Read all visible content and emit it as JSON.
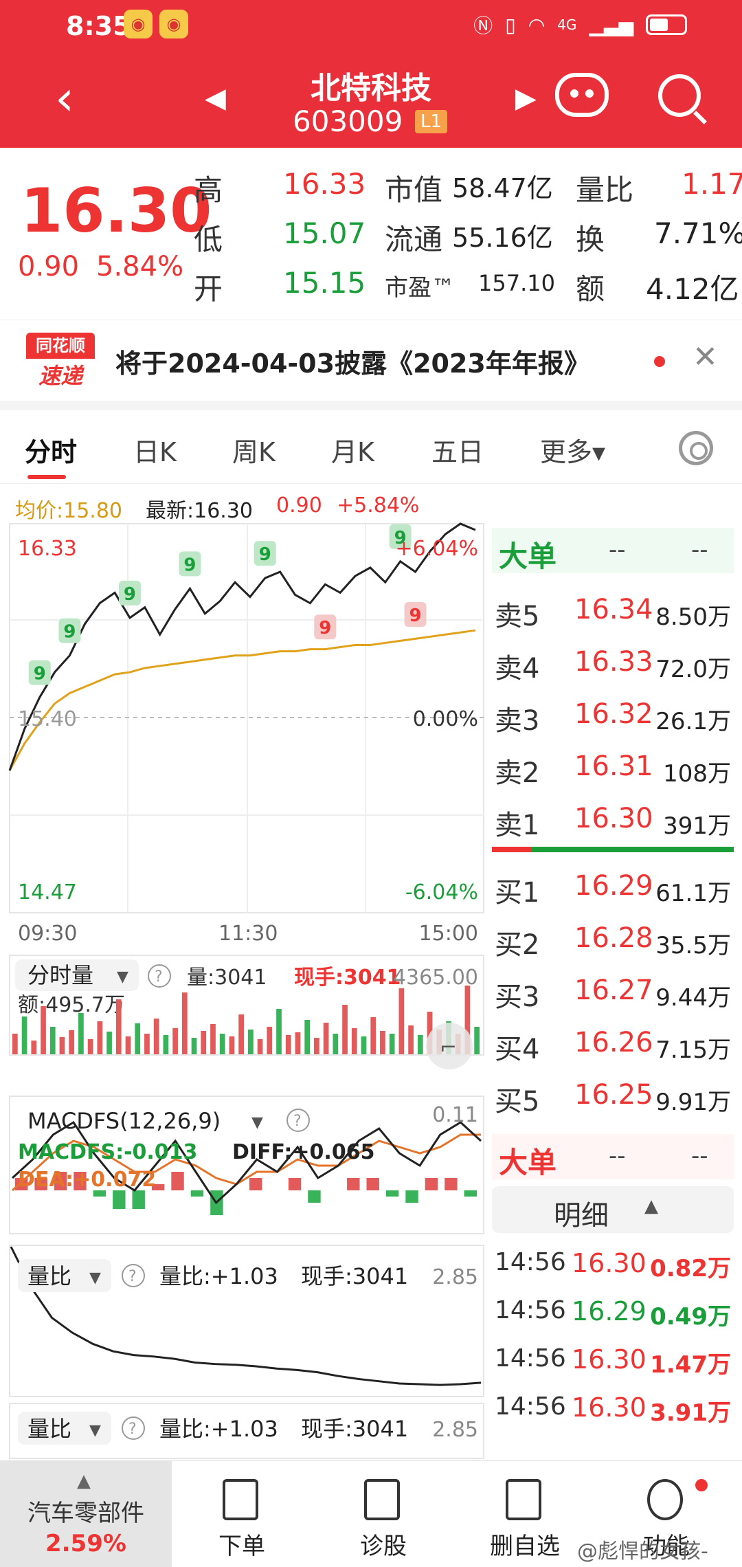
{
  "status": {
    "time": "8:35",
    "network": "4G"
  },
  "header": {
    "title": "北特科技",
    "code": "603009",
    "badge": "L1"
  },
  "quote": {
    "price": "16.30",
    "change": "0.90",
    "change_pct": "5.84%",
    "high_label": "高",
    "high": "16.33",
    "low_label": "低",
    "low": "15.07",
    "open_label": "开",
    "open": "15.15",
    "mktcap_label": "市值",
    "mktcap": "58.47亿",
    "float_label": "流通",
    "float": "55.16亿",
    "pe_label": "市盈™",
    "pe": "157.10",
    "vr_label": "量比",
    "vr": "1.17",
    "turnover_label": "换",
    "turnover": "7.71%",
    "amount_label": "额",
    "amount": "4.12亿"
  },
  "notice": {
    "logo_top": "同花顺",
    "logo_bottom": "速递",
    "text": "将于2024-04-03披露《2023年年报》"
  },
  "tabs": [
    {
      "label": "分时"
    },
    {
      "label": "日K"
    },
    {
      "label": "周K"
    },
    {
      "label": "月K"
    },
    {
      "label": "五日"
    },
    {
      "label": "更多▾"
    }
  ],
  "chart_top": {
    "avg_label": "均价:15.80",
    "last_label": "最新:16.30",
    "chg": "0.90",
    "pct": "+5.84%"
  },
  "chart_data": [
    {
      "type": "line",
      "x_ticks": [
        "09:30",
        "11:30",
        "15:00"
      ],
      "ylim": [
        14.47,
        16.33
      ],
      "y_top_label": "16.33",
      "y_mid_label": "15.40",
      "y_bottom_label": "14.47",
      "pct_top": "+6.04%",
      "pct_mid": "0.00%",
      "pct_bottom": "-6.04%",
      "series": [
        {
          "values": [
            15.15,
            15.35,
            15.5,
            15.62,
            15.7,
            15.85,
            15.95,
            16.0,
            15.88,
            15.93,
            15.8,
            15.92,
            16.02,
            15.9,
            15.96,
            16.05,
            15.98,
            16.07,
            16.1,
            15.99,
            15.95,
            16.04,
            16.0,
            16.08,
            16.12,
            16.05,
            16.15,
            16.1,
            16.2,
            16.28,
            16.33,
            16.3
          ]
        },
        {
          "values": [
            15.15,
            15.28,
            15.38,
            15.47,
            15.52,
            15.55,
            15.58,
            15.61,
            15.62,
            15.64,
            15.65,
            15.66,
            15.67,
            15.68,
            15.69,
            15.7,
            15.7,
            15.71,
            15.72,
            15.72,
            15.73,
            15.73,
            15.74,
            15.75,
            15.75,
            15.76,
            15.77,
            15.78,
            15.79,
            15.8,
            15.81,
            15.82
          ]
        }
      ],
      "markers": [
        "9",
        "9",
        "9",
        "9",
        "9",
        "9",
        "9",
        "9",
        "9"
      ]
    },
    {
      "type": "bar",
      "title": "分时量",
      "vol_label": "量:3041",
      "hand_label": "现手:3041",
      "max_label": "4365.00",
      "amt_label": "额:495.7万",
      "values": [
        30,
        55,
        20,
        70,
        40,
        25,
        35,
        60,
        22,
        48,
        33,
        80,
        26,
        45,
        30,
        52,
        28,
        38,
        90,
        24,
        34,
        44,
        30,
        26,
        58,
        36,
        22,
        40,
        66,
        28,
        32,
        50,
        24,
        46,
        30,
        72,
        38,
        26,
        54,
        34,
        30,
        96,
        42,
        28,
        62,
        36,
        48,
        30,
        100,
        40
      ]
    },
    {
      "type": "line",
      "title": "MACDFS(12,26,9)",
      "macd_label": "MACDFS:-0.013",
      "diff_label": "DIFF:+0.065",
      "dea_label": "DEA:+0.072",
      "max_label": "0.11",
      "series": [
        {
          "values": [
            0.02,
            0.05,
            0.09,
            0.11,
            0.06,
            0.02,
            0.0,
            0.04,
            0.08,
            0.03,
            -0.02,
            0.01,
            0.05,
            0.03,
            0.07,
            0.02,
            0.04,
            0.08,
            0.1,
            0.06,
            0.04,
            0.09,
            0.11,
            0.08
          ]
        },
        {
          "values": [
            0.0,
            0.03,
            0.06,
            0.08,
            0.07,
            0.05,
            0.03,
            0.03,
            0.05,
            0.04,
            0.02,
            0.01,
            0.03,
            0.03,
            0.05,
            0.04,
            0.04,
            0.06,
            0.08,
            0.07,
            0.06,
            0.07,
            0.09,
            0.09
          ]
        }
      ],
      "bars": [
        0.02,
        0.02,
        0.03,
        0.03,
        -0.01,
        -0.03,
        -0.03,
        0.01,
        0.03,
        -0.01,
        -0.04,
        0.0,
        0.02,
        0.0,
        0.02,
        -0.02,
        0.0,
        0.02,
        0.02,
        -0.01,
        -0.02,
        0.02,
        0.02,
        -0.01
      ]
    },
    {
      "type": "line",
      "title": "量比",
      "value_label": "量比:+1.03",
      "hand_label": "现手:3041",
      "max_label": "2.85",
      "series": [
        {
          "values": [
            2.85,
            2.3,
            1.9,
            1.7,
            1.55,
            1.45,
            1.4,
            1.38,
            1.35,
            1.3,
            1.28,
            1.27,
            1.25,
            1.22,
            1.2,
            1.17,
            1.12,
            1.08,
            1.05,
            1.02,
            1.01,
            1.0,
            1.01,
            1.03
          ]
        }
      ]
    },
    {
      "type": "line",
      "title": "量比",
      "value_label": "量比:+1.03",
      "hand_label": "现手:3041",
      "max_label": "2.85"
    }
  ],
  "book": {
    "title": "大单",
    "dash1": "--",
    "dash2": "--",
    "asks": [
      {
        "label": "卖5",
        "price": "16.34",
        "vol": "8.50万"
      },
      {
        "label": "卖4",
        "price": "16.33",
        "vol": "72.0万"
      },
      {
        "label": "卖3",
        "price": "16.32",
        "vol": "26.1万"
      },
      {
        "label": "卖2",
        "price": "16.31",
        "vol": "108万"
      },
      {
        "label": "卖1",
        "price": "16.30",
        "vol": "391万"
      }
    ],
    "bids": [
      {
        "label": "买1",
        "price": "16.29",
        "vol": "61.1万"
      },
      {
        "label": "买2",
        "price": "16.28",
        "vol": "35.5万"
      },
      {
        "label": "买3",
        "price": "16.27",
        "vol": "9.44万"
      },
      {
        "label": "买4",
        "price": "16.26",
        "vol": "7.15万"
      },
      {
        "label": "买5",
        "price": "16.25",
        "vol": "9.91万"
      }
    ],
    "title2": "大单",
    "dash3": "--",
    "dash4": "--",
    "detail_label": "明细",
    "ticks": [
      {
        "time": "14:56",
        "price": "16.30",
        "vol": "0.82万",
        "dir": "red"
      },
      {
        "time": "14:56",
        "price": "16.29",
        "vol": "0.49万",
        "dir": "green"
      },
      {
        "time": "14:56",
        "price": "16.30",
        "vol": "1.47万",
        "dir": "red"
      },
      {
        "time": "14:56",
        "price": "16.30",
        "vol": "3.91万",
        "dir": "red"
      }
    ]
  },
  "bottom": {
    "sector_name": "汽车零部件",
    "sector_pct": "2.59%",
    "items": [
      {
        "label": "下单"
      },
      {
        "label": "诊股"
      },
      {
        "label": "删自选"
      },
      {
        "label": "功能"
      }
    ],
    "watermark": "@彪悍的女孩-"
  }
}
